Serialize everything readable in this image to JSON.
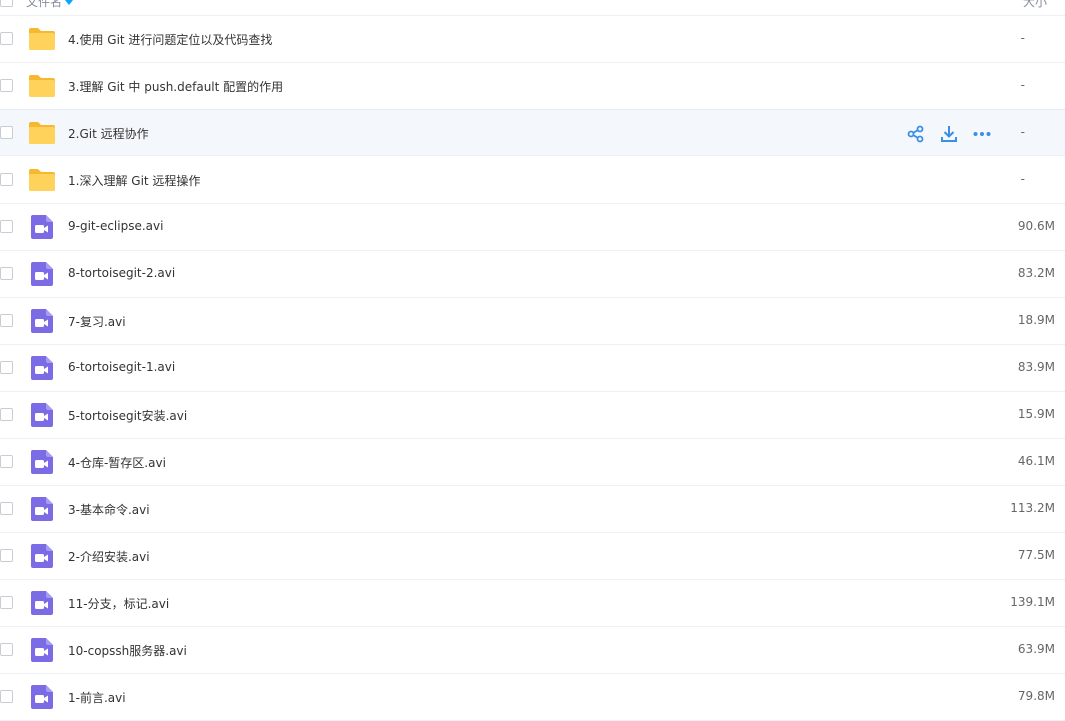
{
  "header": {
    "name_label": "文件名",
    "size_label": "大小"
  },
  "colors": {
    "folder": "#ffd25b",
    "video": "#7b6ce6",
    "accent": "#06a7ff",
    "action_icon": "#3a8ee6"
  },
  "rows": [
    {
      "type": "folder",
      "name": "4.使用 Git 进行问题定位以及代码查找",
      "size": "-"
    },
    {
      "type": "folder",
      "name": "3.理解 Git 中 push.default 配置的作用",
      "size": "-"
    },
    {
      "type": "folder",
      "name": "2.Git 远程协作",
      "size": "-",
      "hover": true
    },
    {
      "type": "folder",
      "name": "1.深入理解 Git 远程操作",
      "size": "-"
    },
    {
      "type": "video",
      "name": "9-git-eclipse.avi",
      "size": "90.6M"
    },
    {
      "type": "video",
      "name": "8-tortoisegit-2.avi",
      "size": "83.2M"
    },
    {
      "type": "video",
      "name": "7-复习.avi",
      "size": "18.9M"
    },
    {
      "type": "video",
      "name": "6-tortoisegit-1.avi",
      "size": "83.9M"
    },
    {
      "type": "video",
      "name": "5-tortoisegit安装.avi",
      "size": "15.9M"
    },
    {
      "type": "video",
      "name": "4-仓库-暂存区.avi",
      "size": "46.1M"
    },
    {
      "type": "video",
      "name": "3-基本命令.avi",
      "size": "113.2M"
    },
    {
      "type": "video",
      "name": "2-介绍安装.avi",
      "size": "77.5M"
    },
    {
      "type": "video",
      "name": "11-分支，标记.avi",
      "size": "139.1M"
    },
    {
      "type": "video",
      "name": "10-copssh服务器.avi",
      "size": "63.9M"
    },
    {
      "type": "video",
      "name": "1-前言.avi",
      "size": "79.8M"
    }
  ],
  "hover_actions": [
    {
      "icon": "share-icon"
    },
    {
      "icon": "download-icon"
    },
    {
      "icon": "more-icon"
    }
  ]
}
